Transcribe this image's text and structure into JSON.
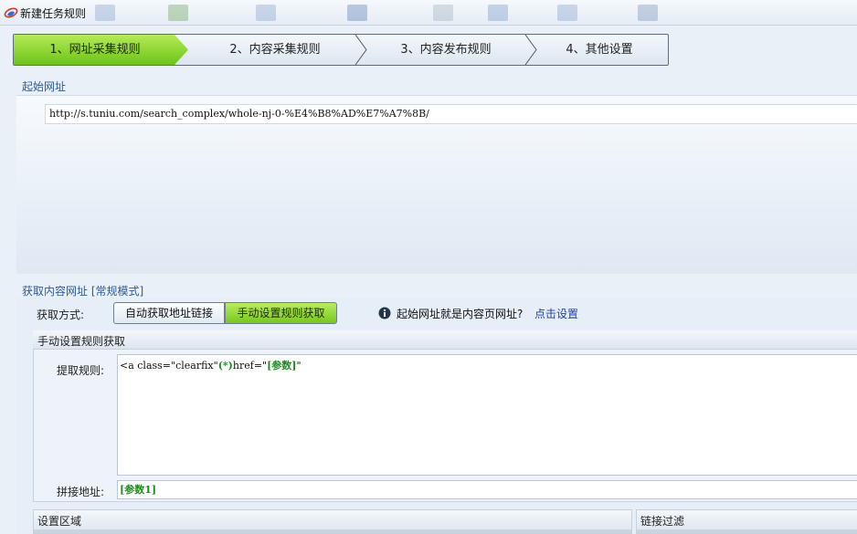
{
  "window": {
    "title": "新建任务规则"
  },
  "steps": [
    {
      "label": "1、网址采集规则"
    },
    {
      "label": "2、内容采集规则"
    },
    {
      "label": "3、内容发布规则"
    },
    {
      "label": "4、其他设置"
    }
  ],
  "start_url": {
    "section_label": "起始网址",
    "value": "http://s.tuniu.com/search_complex/whole-nj-0-%E4%B8%AD%E7%A7%8B/"
  },
  "fetch": {
    "section_label": "获取内容网址 [常规模式]",
    "method_label": "获取方式:",
    "auto_button": "自动获取地址链接",
    "manual_button": "手动设置规则获取",
    "info_text": "起始网址就是内容页网址?",
    "info_link": "点击设置"
  },
  "manual_group": {
    "header": "手动设置规则获取",
    "rule_label": "提取规则:",
    "rule_prefix": "<a class=\"clearfix\"",
    "rule_wildcard": "(*)",
    "rule_middle": "href=\"",
    "rule_param": "[参数]",
    "rule_suffix": "\"",
    "concat_label": "拼接地址:",
    "concat_value": "[参数1]"
  },
  "bottom": {
    "settings_area": "设置区域",
    "link_filter": "链接过滤"
  },
  "colors": {
    "active_green": "#77c81d",
    "section_blue": "#2c5a95",
    "link_blue": "#1f3faa",
    "param_green": "#1f8a1f"
  }
}
